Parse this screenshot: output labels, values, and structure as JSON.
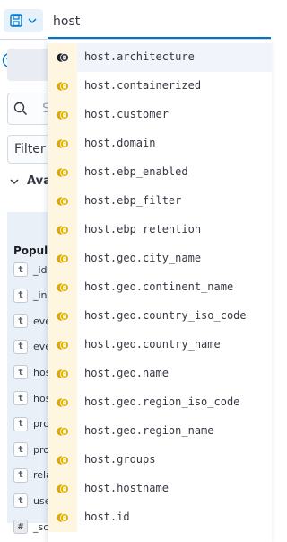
{
  "query": {
    "value": "host"
  },
  "sidebar": {
    "search_placeholder": "S",
    "filter_label": "Filter",
    "available_label": "Ava",
    "popular_label": "Popula",
    "fields": [
      {
        "type": "t",
        "name": "_id"
      },
      {
        "type": "t",
        "name": "_ind"
      },
      {
        "type": "t",
        "name": "eve"
      },
      {
        "type": "t",
        "name": "eve"
      },
      {
        "type": "t",
        "name": "hos"
      },
      {
        "type": "t",
        "name": "hos"
      },
      {
        "type": "t",
        "name": "pro"
      },
      {
        "type": "t",
        "name": "pro"
      },
      {
        "type": "t",
        "name": "rela"
      },
      {
        "type": "t",
        "name": "use"
      },
      {
        "type": "#",
        "name": "_sc"
      }
    ]
  },
  "suggestions": [
    "host.architecture",
    "host.containerized",
    "host.customer",
    "host.domain",
    "host.ebp_enabled",
    "host.ebp_filter",
    "host.ebp_retention",
    "host.geo.city_name",
    "host.geo.continent_name",
    "host.geo.country_iso_code",
    "host.geo.country_name",
    "host.geo.name",
    "host.geo.region_iso_code",
    "host.geo.region_name",
    "host.groups",
    "host.hostname",
    "host.id"
  ],
  "colors": {
    "accent": "#0077cc",
    "field_icon": "#ddaa00",
    "field_icon_bg": "#fef6e0"
  }
}
